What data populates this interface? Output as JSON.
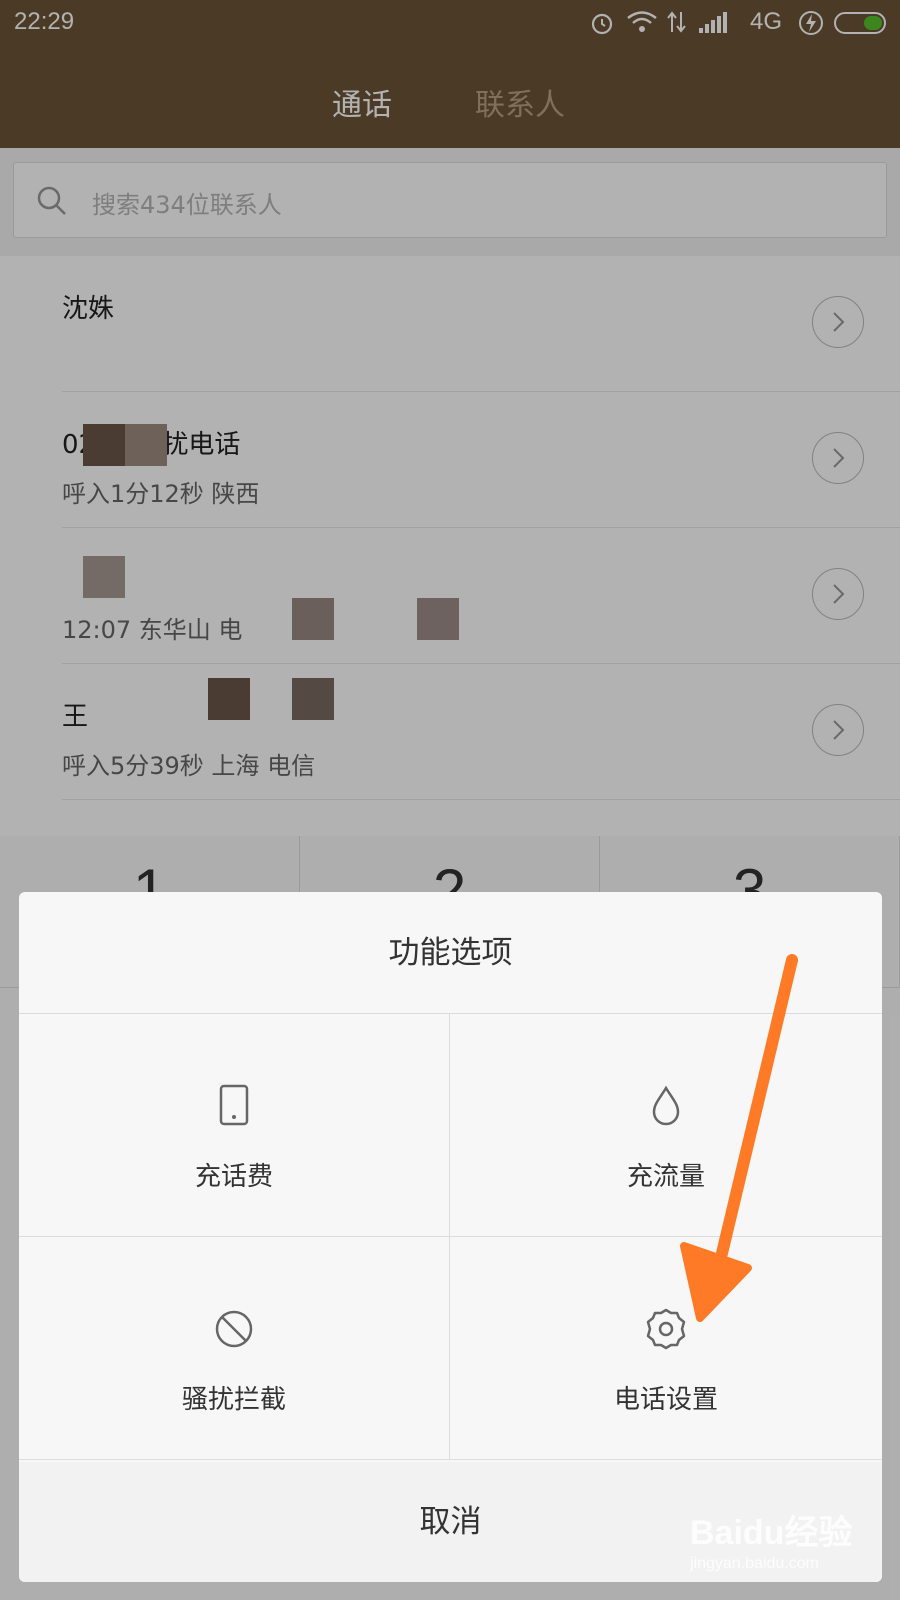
{
  "status_bar": {
    "time": "22:29",
    "network": "4G"
  },
  "tabs": [
    {
      "label": "通话"
    },
    {
      "label": "联系人"
    }
  ],
  "search": {
    "placeholder": "搜索434位联系人"
  },
  "call_log": [
    {
      "line1": "沈姝",
      "line2": ""
    },
    {
      "line1": "0298      骚扰电话",
      "line2": "呼入1分12秒 陕西"
    },
    {
      "line1": "",
      "line2": "12:07        东华山 电"
    },
    {
      "line1": "王",
      "line2": "呼入5分39秒 上海 电信"
    }
  ],
  "dialpad": {
    "keys": [
      "1",
      "2",
      "3"
    ]
  },
  "options_sheet": {
    "title": "功能选项",
    "options": [
      {
        "label": "充话费",
        "icon": "phone-icon"
      },
      {
        "label": "充流量",
        "icon": "water-drop-icon"
      },
      {
        "label": "骚扰拦截",
        "icon": "block-icon"
      },
      {
        "label": "电话设置",
        "icon": "gear-icon"
      }
    ],
    "cancel_label": "取消"
  },
  "annotation": {
    "arrow_color": "#ff7a26"
  },
  "watermark": {
    "brand": "Baidu经验",
    "url": "jingyan.baidu.com"
  },
  "colors": {
    "header": "#6c5437",
    "active_tab": "#ffffff",
    "inactive_tab": "#b79f85"
  }
}
